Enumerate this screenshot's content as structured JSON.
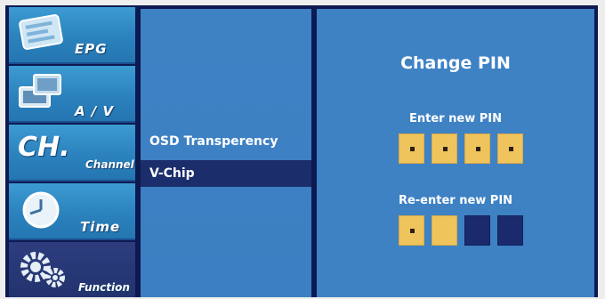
{
  "sidebar": {
    "items": [
      {
        "label": "EPG",
        "icon": "epg-guide-icon",
        "active": false
      },
      {
        "label": "A / V",
        "icon": "av-monitor-icon",
        "active": false
      },
      {
        "label": "Channel",
        "icon_text": "CH.",
        "icon": "channel-icon",
        "active": false
      },
      {
        "label": "Time",
        "icon": "clock-icon",
        "active": false
      },
      {
        "label": "Function",
        "icon": "gears-icon",
        "active": true
      }
    ]
  },
  "menu": {
    "items": [
      {
        "label": "OSD Transperency",
        "selected": false
      },
      {
        "label": "V-Chip",
        "selected": true
      }
    ]
  },
  "pin_dialog": {
    "title": "Change PIN",
    "enter_label": "Enter new PIN",
    "reenter_label": "Re-enter new PIN",
    "entered_digits": 4,
    "reentered_digits": 1,
    "pin_length": 4
  },
  "colors": {
    "panel_blue": "#3e82c4",
    "selected_navy": "#1c2d6b",
    "pin_filled": "#f0c45c",
    "pin_empty": "#1a2a6c"
  }
}
